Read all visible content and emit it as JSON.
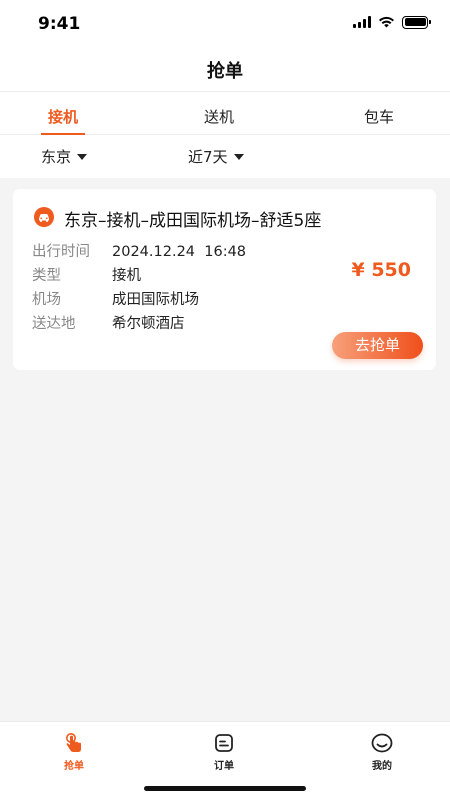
{
  "status_bar": {
    "time": "9:41"
  },
  "nav": {
    "title": "抢单"
  },
  "tabs": [
    {
      "label": "接机",
      "active": true
    },
    {
      "label": "送机",
      "active": false
    },
    {
      "label": "包车",
      "active": false
    }
  ],
  "filters": {
    "city": "东京",
    "date_range": "近7天"
  },
  "orders": [
    {
      "title": "东京–接机–成田国际机场–舒适5座",
      "departure_label": "出行时间",
      "departure_value": "2024.12.24  16:48",
      "type_label": "类型",
      "type_value": "接机",
      "airport_label": "机场",
      "airport_value": "成田国际机场",
      "destination_label": "送达地",
      "destination_value": "希尔顿酒店",
      "price": "¥ 550",
      "action_label": "去抢单"
    }
  ],
  "bottom_nav": [
    {
      "label": "抢单",
      "icon": "hand-tap-icon",
      "active": true
    },
    {
      "label": "订单",
      "icon": "order-list-icon",
      "active": false
    },
    {
      "label": "我的",
      "icon": "profile-face-icon",
      "active": false
    }
  ],
  "colors": {
    "accent": "#ef5a1e",
    "background": "#f4f4f4"
  }
}
